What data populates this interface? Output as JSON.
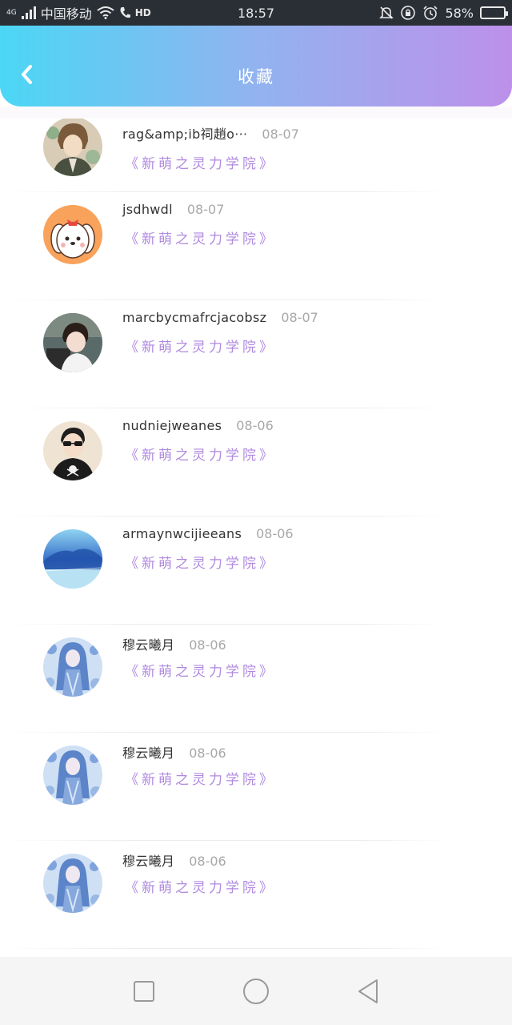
{
  "status": {
    "network": "4G",
    "carrier": "中国移动",
    "hd": "HD",
    "time": "18:57",
    "battery": "58%",
    "battery_level": 0.58
  },
  "header": {
    "title": "收藏",
    "back_icon": "chevron-left-icon"
  },
  "colors": {
    "header_gradient_start": "#4bd7f5",
    "header_gradient_end": "#bd90ea",
    "book_title": "#b08ae0",
    "date": "#a8a8a8"
  },
  "favorites": [
    {
      "username": "rag&amp;ib祠趙o···",
      "date": "08-07",
      "book": "《新萌之灵力学院》",
      "avatar": "anime-boy"
    },
    {
      "username": "jsdhwdl",
      "date": "08-07",
      "book": "《新萌之灵力学院》",
      "avatar": "cartoon-dog"
    },
    {
      "username": "marcbycmafrcjacobsz",
      "date": "08-07",
      "book": "《新萌之灵力学院》",
      "avatar": "photo-boy"
    },
    {
      "username": "nudniejweanes",
      "date": "08-06",
      "book": "《新萌之灵力学院》",
      "avatar": "sunglasses-man"
    },
    {
      "username": "armaynwcijieeans",
      "date": "08-06",
      "book": "《新萌之灵力学院》",
      "avatar": "blue-landscape"
    },
    {
      "username": "穆云曦月",
      "date": "08-06",
      "book": "《新萌之灵力学院》",
      "avatar": "blue-anime-girl"
    },
    {
      "username": "穆云曦月",
      "date": "08-06",
      "book": "《新萌之灵力学院》",
      "avatar": "blue-anime-girl"
    },
    {
      "username": "穆云曦月",
      "date": "08-06",
      "book": "《新萌之灵力学院》",
      "avatar": "blue-anime-girl"
    }
  ],
  "nav": {
    "recents_icon": "square-icon",
    "home_icon": "circle-icon",
    "back_icon": "triangle-back-icon"
  }
}
